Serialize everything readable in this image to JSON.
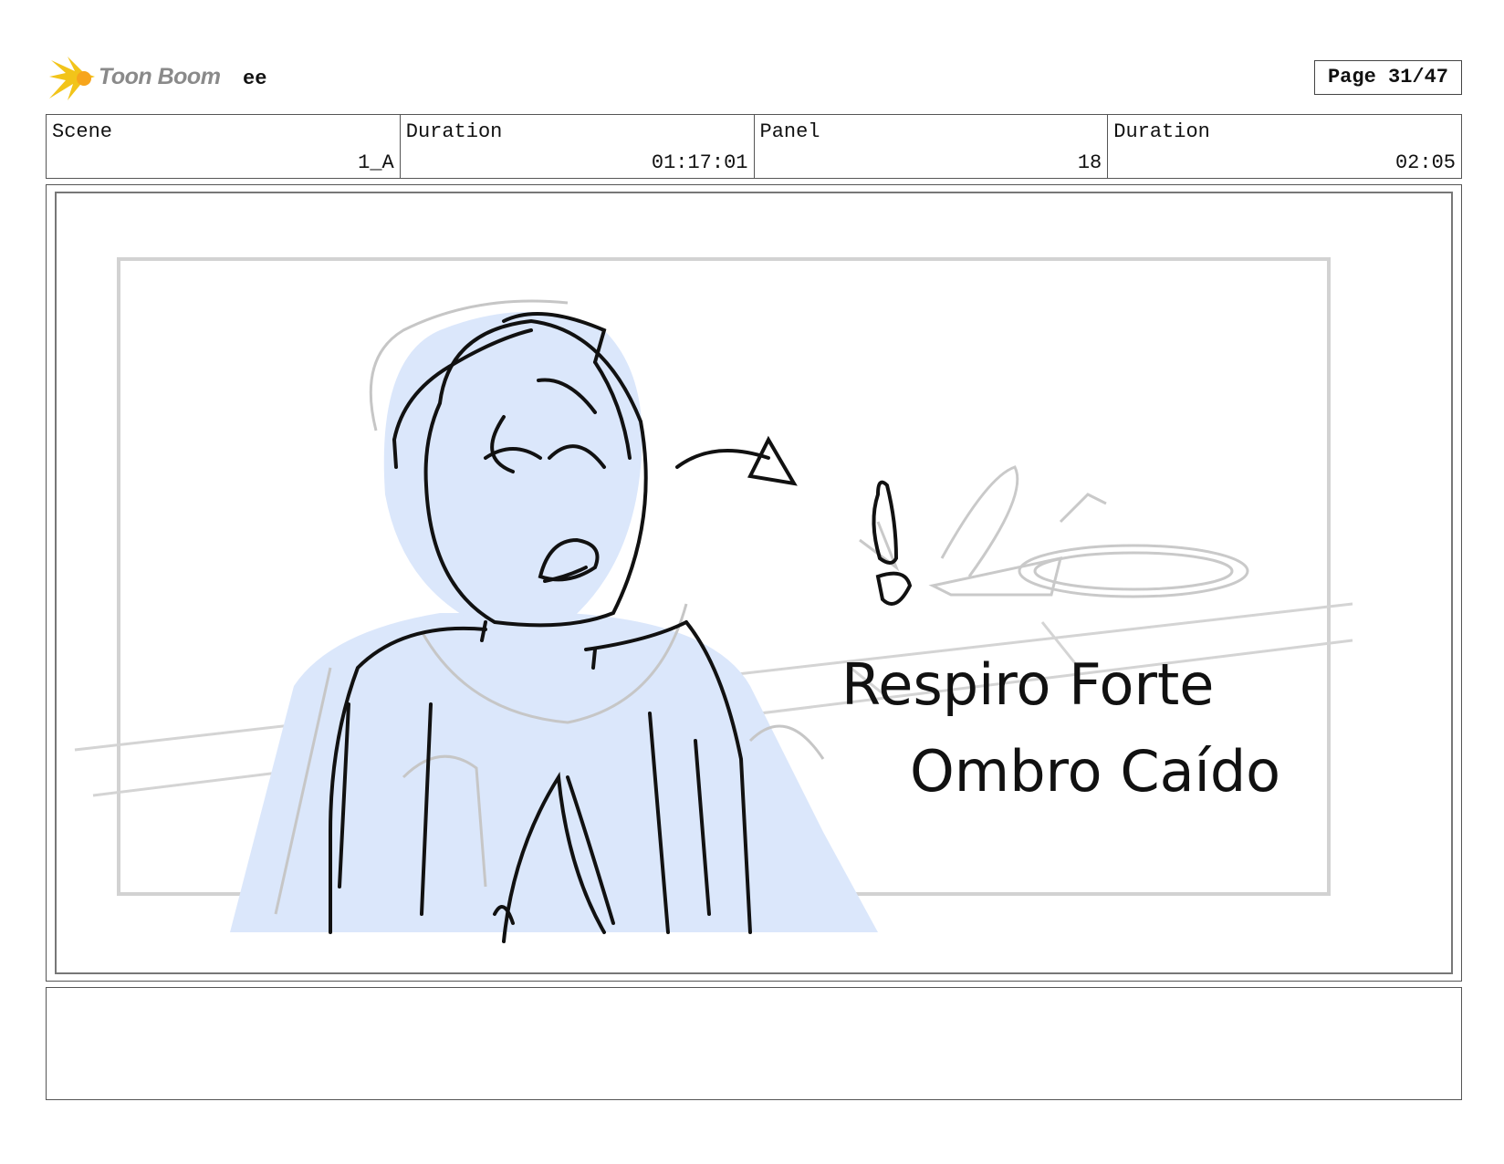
{
  "header": {
    "logo_text": "Toon Boom",
    "project": "ee",
    "page": "Page 31/47"
  },
  "info": {
    "scene_label": "Scene",
    "scene_value": "1_A",
    "scene_duration_label": "Duration",
    "scene_duration_value": "01:17:01",
    "panel_label": "Panel",
    "panel_value": "18",
    "panel_duration_label": "Duration",
    "panel_duration_value": "02:05"
  },
  "panel": {
    "handwritten_note": "Respiro Forte / Ombro Caído"
  },
  "notes": {
    "text": ""
  },
  "colors": {
    "sketch_fill": "#dbe7fb",
    "logo_yellow": "#f2c41a"
  },
  "icons": {
    "logo": "toon-boom-starburst-icon"
  }
}
